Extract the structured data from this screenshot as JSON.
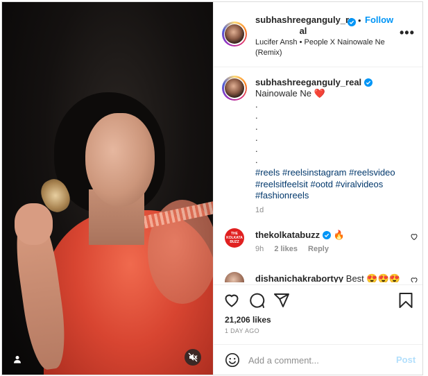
{
  "post": {
    "username": "subhashreeganguly_real",
    "username_display_lines": [
      "subhashreeganguly_re",
      "al"
    ],
    "verified": true,
    "follow_label": "Follow",
    "separator": "•",
    "audio": "Lucifer Ansh • People X Nainowale Ne (Remix)"
  },
  "caption": {
    "username": "subhashreeganguly_real",
    "text": "Nainowale Ne",
    "emoji": "❤️",
    "dots": [
      ".",
      ".",
      ".",
      ".",
      ".",
      "."
    ],
    "hashtags": "#reels #reelsinstagram #reelsvideo #reelsitfeelsit #ootd #viralvideos #fashionreels",
    "time": "1d"
  },
  "comments": [
    {
      "username": "thekolkatabuzz",
      "verified": true,
      "text": "🔥",
      "avatar_text": "THE KOLKATA BUZZ",
      "time": "9h",
      "likes": "2 likes",
      "reply_label": "Reply"
    },
    {
      "username": "dishanichakrabortyy",
      "verified": false,
      "text": "Best 😍😍😍"
    }
  ],
  "actions": {
    "icons": [
      "heart-icon",
      "comment-icon",
      "share-icon",
      "bookmark-icon"
    ],
    "likes": "21,206 likes",
    "time_ago": "1 DAY AGO"
  },
  "add_comment": {
    "placeholder": "Add a comment...",
    "post_label": "Post"
  },
  "colors": {
    "link_blue": "#0095f6",
    "hashtag": "#00376b",
    "muted": "#8e8e8e",
    "post_disabled": "#b2dffc",
    "heart_red": "#ed4956"
  }
}
